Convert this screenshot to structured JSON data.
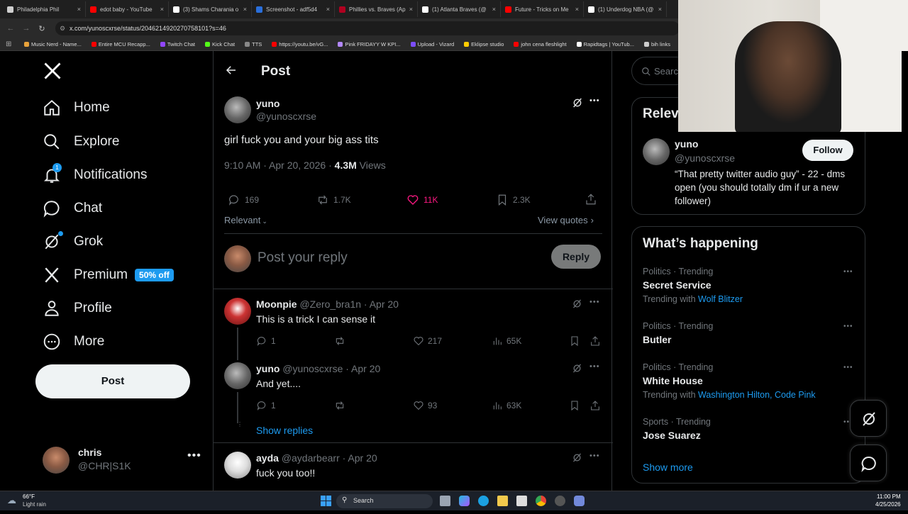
{
  "browser": {
    "tabs": [
      {
        "label": "Philadelphia Phil",
        "color": "#cfcfcf"
      },
      {
        "label": "edot baby - YouTube",
        "color": "#ff0000"
      },
      {
        "label": "(3) Shams Charania o",
        "color": "#ffffff"
      },
      {
        "label": "Screenshot - adf5d4",
        "color": "#2a6fdb"
      },
      {
        "label": "Phillies vs. Braves (Ap",
        "color": "#b00020"
      },
      {
        "label": "(1) Atlanta Braves (@",
        "color": "#ffffff"
      },
      {
        "label": "Future - Tricks on Me",
        "color": "#ff0000"
      },
      {
        "label": "(1) Underdog NBA (@",
        "color": "#ffffff"
      }
    ],
    "url": "x.com/yunoscxrse/status/2046214920270758101?s=46",
    "bookmarks": [
      {
        "label": "Music Nerd - Name...",
        "color": "#e8a23a"
      },
      {
        "label": "Entire MCU Recapp...",
        "color": "#ff0000"
      },
      {
        "label": "Twitch Chat",
        "color": "#9146ff"
      },
      {
        "label": "Kick Chat",
        "color": "#53fc18"
      },
      {
        "label": "TTS",
        "color": "#888888"
      },
      {
        "label": "https://youtu.be/vG...",
        "color": "#ff0000"
      },
      {
        "label": "Pink FRIDAYY W KPI...",
        "color": "#b388ff"
      },
      {
        "label": "Upload - Vizard",
        "color": "#7c4dff"
      },
      {
        "label": "Eklipse studio",
        "color": "#ffcc00"
      },
      {
        "label": "john cena fleshlight",
        "color": "#ff0000"
      },
      {
        "label": "Rapidtags | YouTub...",
        "color": "#ffffff"
      },
      {
        "label": "bih links",
        "color": "#cccccc"
      }
    ]
  },
  "nav": {
    "home": "Home",
    "explore": "Explore",
    "notifications": "Notifications",
    "notifications_badge": "1",
    "chat": "Chat",
    "grok": "Grok",
    "premium": "Premium",
    "premium_badge": "50% off",
    "profile": "Profile",
    "more": "More",
    "post_button": "Post",
    "account_name": "chris",
    "account_handle": "@CHR|S1K"
  },
  "post": {
    "header_title": "Post",
    "author_name": "yuno",
    "author_handle": "@yunoscxrse",
    "text": "girl fuck you and your big ass tits",
    "timestamp": "9:10 AM · Apr 20, 2026 · ",
    "views_count": "4.3M",
    "views_label": " Views",
    "replies": "169",
    "reposts": "1.7K",
    "likes": "11K",
    "bookmarks": "2.3K",
    "sort_label": "Relevant",
    "view_quotes": "View quotes",
    "reply_placeholder": "Post your reply",
    "reply_button": "Reply"
  },
  "replies": [
    {
      "name": "Moonpie",
      "handle": "@Zero_bra1n · Apr 20",
      "text": "This is a trick I can sense it",
      "replies": "1",
      "likes": "217",
      "views": "65K"
    },
    {
      "name": "yuno",
      "handle": "@yunoscxrse · Apr 20",
      "text": "And yet....",
      "replies": "1",
      "likes": "93",
      "views": "63K"
    },
    {
      "name": "ayda",
      "handle": "@aydarbearr · Apr 20",
      "text": "fuck you too!!",
      "replies": "",
      "likes": "",
      "views": ""
    }
  ],
  "show_replies": "Show replies",
  "sidebar": {
    "search_placeholder": "Searc",
    "relevant_title": "Relev",
    "rel_name": "yuno",
    "rel_handle": "@yunoscxrse",
    "follow": "Follow",
    "rel_bio": "“That pretty twitter audio guy” - 22 - dms open (you should totally dm if ur a new follower)",
    "happening_title": "What’s happening",
    "trends": [
      {
        "meta": "Politics · Trending",
        "topic": "Secret Service",
        "with_label": "Trending with ",
        "with": "Wolf Blitzer"
      },
      {
        "meta": "Politics · Trending",
        "topic": "Butler",
        "with_label": "",
        "with": ""
      },
      {
        "meta": "Politics · Trending",
        "topic": "White House",
        "with_label": "Trending with ",
        "with": "Washington Hilton, Code Pink"
      },
      {
        "meta": "Sports · Trending",
        "topic": "Jose Suarez",
        "with_label": "",
        "with": ""
      }
    ],
    "show_more": "Show more"
  },
  "taskbar": {
    "weather_temp": "66°F",
    "weather_desc": "Light rain",
    "search": "Search",
    "time": "11:00 PM",
    "date": "4/25/2026"
  }
}
